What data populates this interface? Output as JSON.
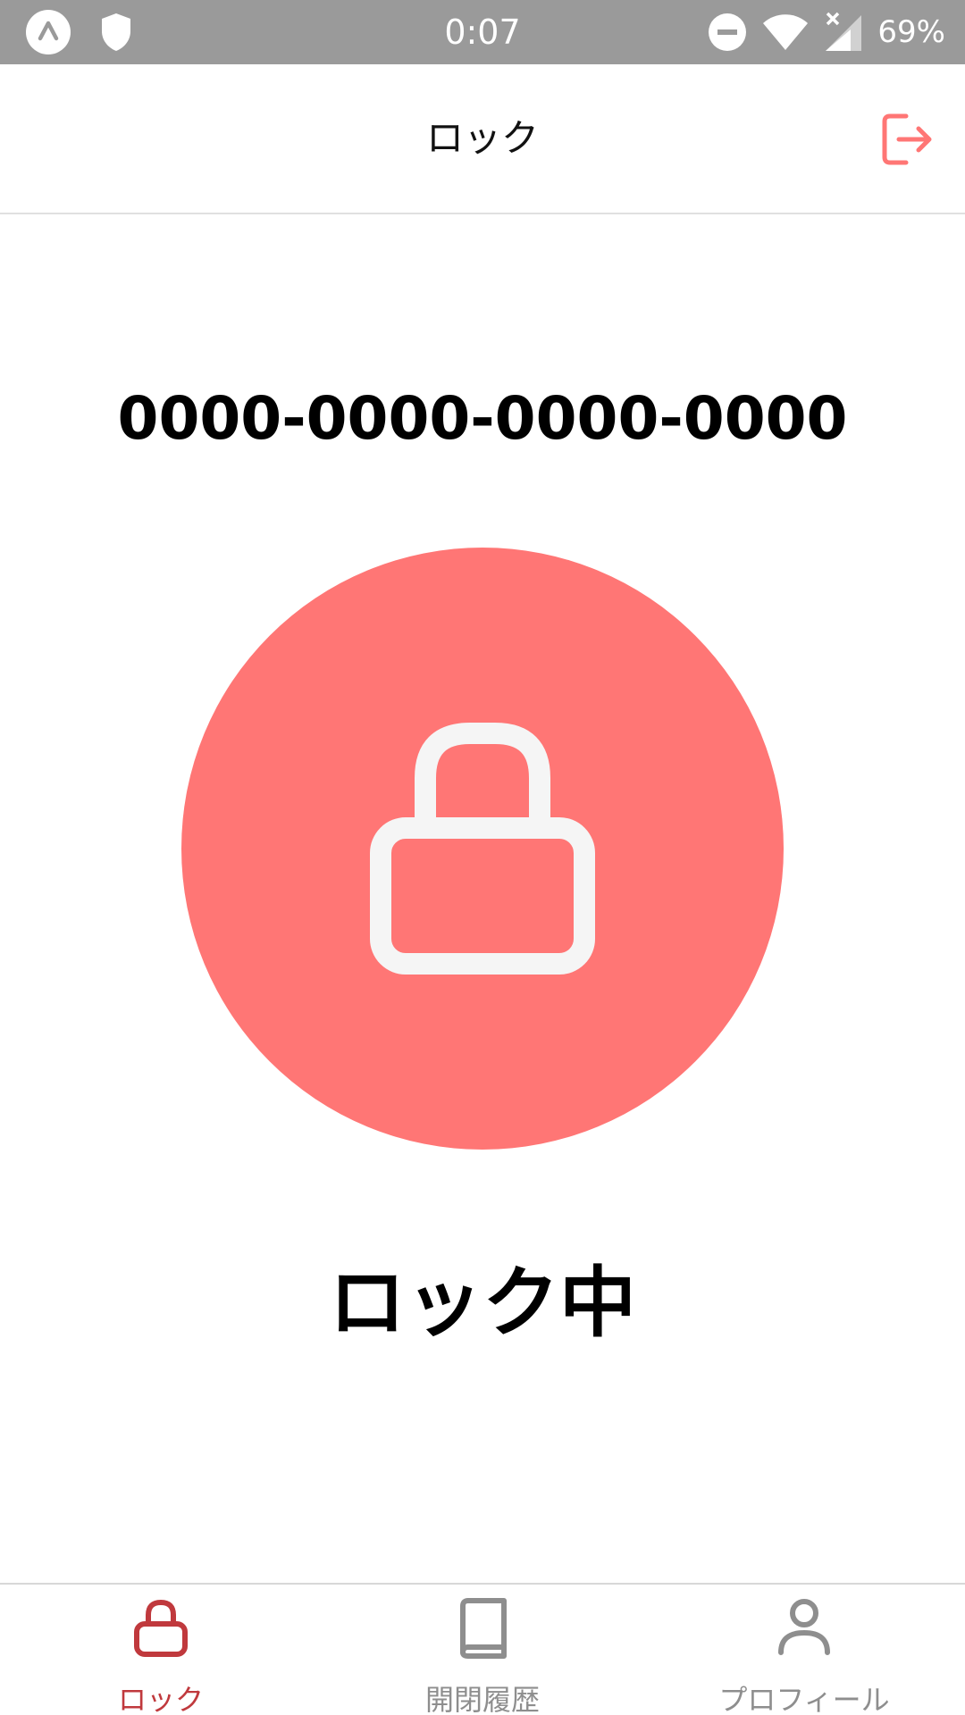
{
  "status_bar": {
    "time": "0:07",
    "battery": "69%",
    "icons": [
      "expo-icon",
      "shield-icon",
      "do-not-disturb-icon",
      "wifi-icon",
      "cell-signal-icon",
      "battery-icon"
    ]
  },
  "header": {
    "title": "ロック",
    "logout_icon": "logout-icon"
  },
  "main": {
    "device_id": "0000-0000-0000-0000",
    "lock_icon": "lock-icon",
    "status_text": "ロック中"
  },
  "bottom_nav": {
    "items": [
      {
        "label": "ロック",
        "icon": "lock-icon",
        "active": true
      },
      {
        "label": "開閉履歴",
        "icon": "book-icon",
        "active": false
      },
      {
        "label": "プロフィール",
        "icon": "user-icon",
        "active": false
      }
    ]
  },
  "colors": {
    "accent": "#ff7675",
    "active_tab": "#c0393d",
    "inactive_tab": "#8e8e8e",
    "status_bar": "#9a9a9a"
  }
}
